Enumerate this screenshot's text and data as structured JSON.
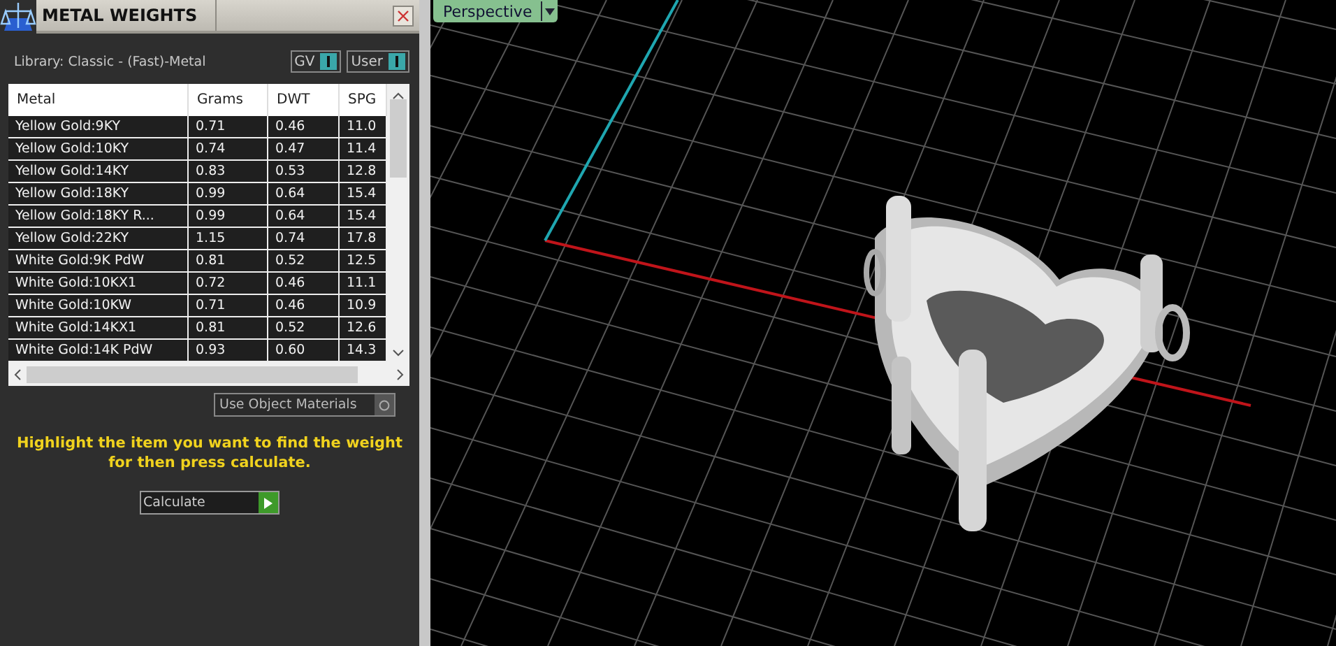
{
  "panel": {
    "title": "METAL WEIGHTS",
    "library": "Library: Classic - (Fast)-Metal",
    "toggles": [
      {
        "label": "GV",
        "on": true
      },
      {
        "label": "User",
        "on": true
      }
    ],
    "table": {
      "columns": [
        "Metal",
        "Grams",
        "DWT",
        "SPG"
      ],
      "rows": [
        [
          "Yellow Gold:9KY",
          "0.71",
          "0.46",
          "11.0"
        ],
        [
          "Yellow Gold:10KY",
          "0.74",
          "0.47",
          "11.4"
        ],
        [
          "Yellow Gold:14KY",
          "0.83",
          "0.53",
          "12.8"
        ],
        [
          "Yellow Gold:18KY",
          "0.99",
          "0.64",
          "15.4"
        ],
        [
          "Yellow Gold:18KY R...",
          "0.99",
          "0.64",
          "15.4"
        ],
        [
          "Yellow Gold:22KY",
          "1.15",
          "0.74",
          "17.8"
        ],
        [
          "White Gold:9K PdW",
          "0.81",
          "0.52",
          "12.5"
        ],
        [
          "White Gold:10KX1",
          "0.72",
          "0.46",
          "11.1"
        ],
        [
          "White Gold:10KW",
          "0.71",
          "0.46",
          "10.9"
        ],
        [
          "White Gold:14KX1",
          "0.81",
          "0.52",
          "12.6"
        ],
        [
          "White Gold:14K PdW",
          "0.93",
          "0.60",
          "14.3"
        ]
      ]
    },
    "use_object_materials": {
      "label": "Use Object Materials",
      "on": false
    },
    "hint": "Highlight the item you want to find the weight for then press calculate.",
    "calculate": "Calculate"
  },
  "viewport": {
    "view_menu": "Perspective"
  }
}
